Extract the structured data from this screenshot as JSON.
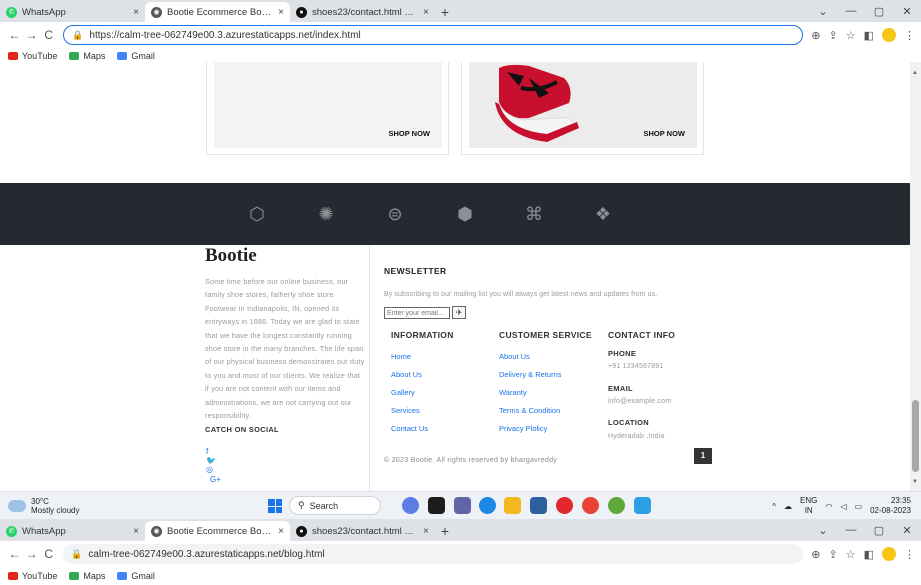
{
  "browser": {
    "tabs": [
      {
        "label": "WhatsApp",
        "close": "×"
      },
      {
        "label": "Bootie Ecommerce Bootstrap Re",
        "close": "×"
      },
      {
        "label": "shoes23/contact.html at main · B",
        "close": "×"
      }
    ],
    "new_tab": "+",
    "url": "https://calm-tree-062749e00.3.azurestaticapps.net/index.html",
    "bookmarks": [
      "YouTube",
      "Maps",
      "Gmail"
    ]
  },
  "browser2": {
    "tabs": [
      {
        "label": "WhatsApp",
        "close": "×"
      },
      {
        "label": "Bootie Ecommerce Bootstrap Re",
        "close": "×"
      },
      {
        "label": "shoes23/contact.html at main · B",
        "close": "×"
      }
    ],
    "url": "calm-tree-062749e00.3.azurestaticapps.net/blog.html",
    "bookmarks": [
      "YouTube",
      "Maps",
      "Gmail"
    ]
  },
  "products": [
    {
      "cta": "SHOP NOW"
    },
    {
      "cta": "SHOP NOW"
    }
  ],
  "footer": {
    "brand": "Bootie",
    "about": "Some time before our online business, our family shoe stores, fatherly shoe store Footwear in Indianapolis, IN, opened its entryways in 1886. Today we are glad to state that we have the longest constantly running shoe store in the many branches. The life span of our physical business demonstrates our duty to you and most of our clients. We realize that if you are not content with our items and administrations, we are not carrying out our responsibility.",
    "catch_on_social": "CATCH ON SOCIAL",
    "social": [
      "f",
      "🐦",
      "◎",
      "G+"
    ],
    "newsletter": {
      "title": "NEWSLETTER",
      "text": "By subscribing to our mailing list you will always get latest news and updates from us.",
      "placeholder": "Enter your email...",
      "submit_icon": "✈"
    },
    "columns": {
      "information": {
        "title": "INFORMATION",
        "links": [
          "Home",
          "About Us",
          "Gallery",
          "Services",
          "Contact Us"
        ]
      },
      "customer_service": {
        "title": "CUSTOMER SERVICE",
        "links": [
          "About Us",
          "Delivery & Returns",
          "Waranty",
          "Terms & Condition",
          "Privacy Plolicy"
        ]
      },
      "contact": {
        "title": "CONTACT INFO",
        "phone_label": "PHONE",
        "phone": "+91 1234567891",
        "email_label": "EMAIL",
        "email": "info@example.com",
        "location_label": "LOCATION",
        "location": "Hyderadab ,India"
      }
    },
    "copyright": "© 2023 Bootie. All rights reserved by bhargavreddy",
    "page_badge": "1"
  },
  "taskbar": {
    "temp": "30°C",
    "weather": "Mostly cloudy",
    "search": "Search",
    "lang1": "ENG",
    "lang2": "IN",
    "time": "23:35",
    "date": "02-08-2023"
  }
}
